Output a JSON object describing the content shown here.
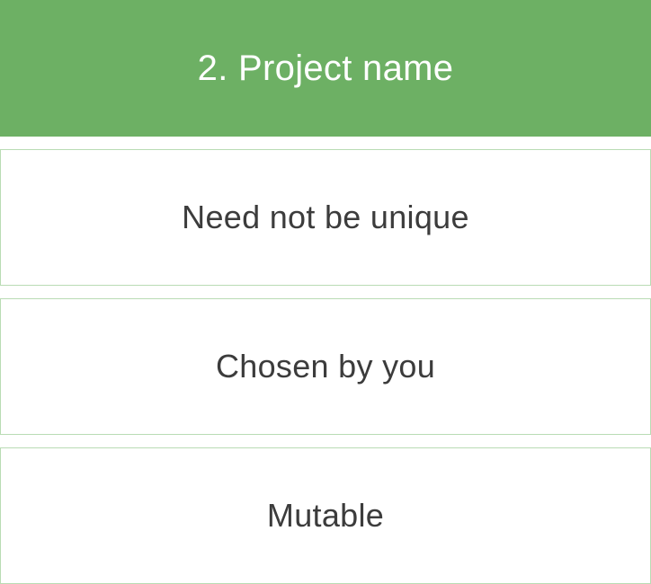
{
  "header": {
    "title": "2. Project name",
    "color": "#6db064"
  },
  "cards": [
    {
      "label": "Need not be unique"
    },
    {
      "label": "Chosen by you"
    },
    {
      "label": "Mutable"
    }
  ],
  "colors": {
    "card_border": "#b9dcb4",
    "card_text": "#3c3c3c"
  }
}
